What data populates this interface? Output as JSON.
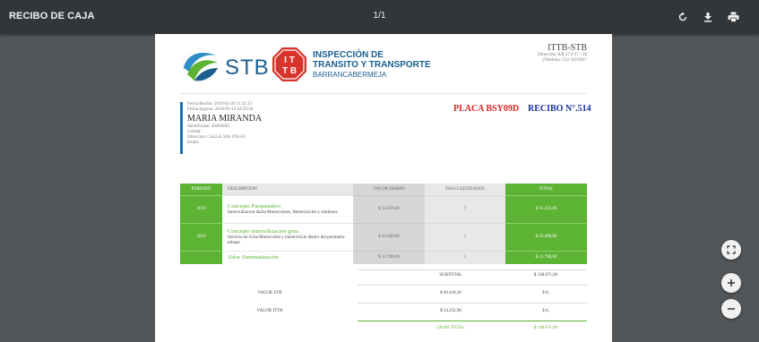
{
  "toolbar": {
    "title": "RECIBO DE CAJA",
    "page_indicator": "1/1",
    "rotate_icon": "rotate-icon",
    "download_icon": "download-icon",
    "print_icon": "print-icon"
  },
  "header": {
    "stb_logo_text": "STB",
    "ittb_line1": "INSPECCIÓN DE",
    "ittb_line2": "TRANSITO Y TRANSPORTE",
    "ittb_line3": "BARRANCABERMEJA",
    "org_name": "ITTB-STB",
    "org_address": "Dirección: KR 27 # 27 - 50",
    "org_phone": "(Telefono: 312 318 6027"
  },
  "client": {
    "fecha_recibo": "Fecha Recibo: 2019-03-20 11:21:13",
    "fecha_ingreso": "Fecha Ingreso: 2019-03-14 10:59:58",
    "name": "MARIA MIRANDA",
    "identificado": "Identificado: 28483856",
    "celular": "Celular:",
    "direccion": "Direccion: CALLE 58A 19A-03",
    "email": "Email:"
  },
  "placa": "PLACA BSY09D",
  "recibo": "RECIBO N°.514",
  "table": {
    "headers": [
      "PERIODO",
      "DESCRIPCION",
      "VALOR DIARIO",
      "DIAS LIQUIDADOS",
      "TOTAL"
    ],
    "rows": [
      {
        "periodo": "2019",
        "concepto": "Concepto Parqueadero",
        "detalle": "Inmovilizacion diaria Motocicletas, Mototriciclos y similares",
        "valor": "$ 13.059,00",
        "dias": "7",
        "total": "$ 91.413,00"
      },
      {
        "periodo": "2019",
        "concepto": "Concepto inmovilizacion grua",
        "detalle": "Servicio de Grúa Motocicleta y mototriciclo dentro del perimetro urbano",
        "valor": "$ 43.460,00",
        "dias": "1",
        "total": "$ 43.460,00"
      },
      {
        "periodo": "",
        "concepto": "Valor Sistematización",
        "detalle": "",
        "valor": "$ 13.798,00",
        "dias": "1",
        "total": "$ 13.798,00"
      }
    ]
  },
  "summary": {
    "subtotal_label": "SUBTOTAL",
    "subtotal_value": "$ 148.671,00",
    "valor_stb_label": "VALOR STB",
    "valor_stb_amount": "$ 94.418,10",
    "valor_stb_total": "$ 0,",
    "valor_ittb_label": "VALOR ITTB",
    "valor_ittb_amount": "$ 54.252,90",
    "valor_ittb_total": "$ 0,",
    "gran_total_label": "GRAN TOTAL",
    "gran_total_value": "$ 148.671,00"
  },
  "zoom_controls": {
    "fit_icon": "fit-page-icon",
    "zoom_in_icon": "zoom-in-icon",
    "zoom_out_icon": "zoom-out-icon"
  },
  "colors": {
    "toolbar": "#323639",
    "viewer_bg": "#525659",
    "green": "#5db334",
    "placa_red": "#e02020",
    "recibo_blue": "#1a2fa5",
    "brand_blue": "#1b5f8f",
    "ittb_red": "#d9342b"
  }
}
